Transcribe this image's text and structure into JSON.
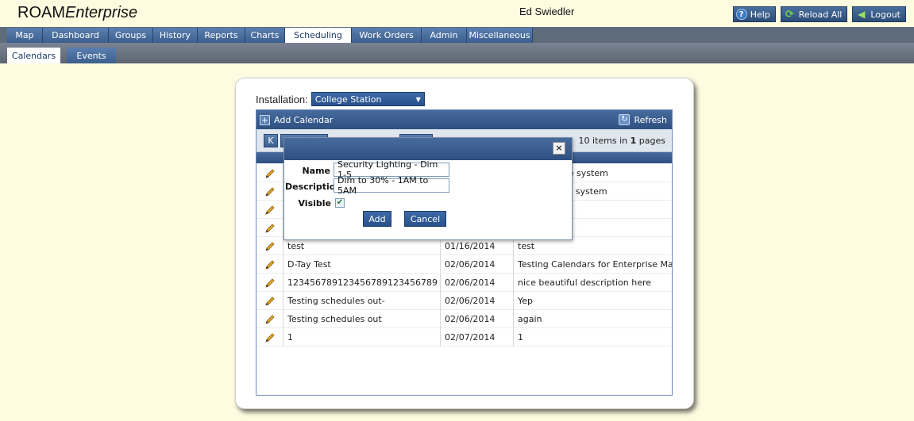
{
  "app": {
    "brand_plain": "ROAM",
    "brand_italic": "Enterprise",
    "user": "Ed Swiedler"
  },
  "top_buttons": {
    "help": "Help",
    "reload": "Reload All",
    "logout": "Logout"
  },
  "nav": [
    "Map",
    "Dashboard",
    "Groups",
    "History",
    "Reports",
    "Charts",
    "Scheduling",
    "Work Orders",
    "Admin",
    "Miscellaneous"
  ],
  "nav_active": "Scheduling",
  "sub_nav": [
    "Calendars",
    "Events"
  ],
  "sub_nav_active": "Calendars",
  "installation": {
    "label": "Installation:",
    "value": "College Station"
  },
  "grid": {
    "add_label": "Add Calendar",
    "refresh_label": "Refresh",
    "first_page": "K",
    "items_count": "10",
    "items_label": "items in",
    "pages_count": "1",
    "pages_label": "pages",
    "rows": [
      {
        "name": "",
        "date": "",
        "desc": "added to the system"
      },
      {
        "name": "",
        "date": "",
        "desc": "ule added to system"
      },
      {
        "name": "",
        "date": "",
        "desc": ""
      },
      {
        "name": "",
        "date": "",
        "desc": ""
      },
      {
        "name": "test",
        "date": "01/16/2014",
        "desc": "test"
      },
      {
        "name": "D-Tay Test",
        "date": "02/06/2014",
        "desc": "Testing Calendars for Enterprise Manual"
      },
      {
        "name": "123456789123456789123456789",
        "date": "02/06/2014",
        "desc": "nice beautiful description here"
      },
      {
        "name": "Testing schedules out-",
        "date": "02/06/2014",
        "desc": "Yep"
      },
      {
        "name": "Testing schedules out",
        "date": "02/06/2014",
        "desc": "again"
      },
      {
        "name": "1",
        "date": "02/07/2014",
        "desc": "1"
      }
    ]
  },
  "dialog": {
    "name_label": "Name",
    "name_value": "Security Lighting - Dim 1-5",
    "desc_label": "Description",
    "desc_value": "Dim to 30% - 1AM to 5AM",
    "visible_label": "Visible",
    "visible_checked": true,
    "add_label": "Add",
    "cancel_label": "Cancel",
    "close_glyph": "×"
  },
  "colors": {
    "background": "#fdfbe0",
    "nav_blue": "#3c5f8e",
    "accent": "#2e5081"
  }
}
